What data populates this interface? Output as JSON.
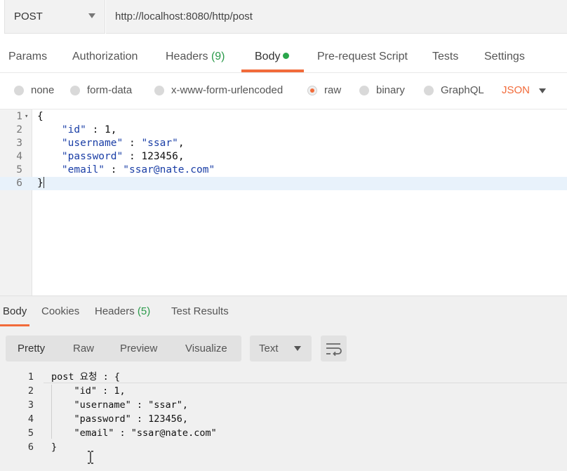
{
  "request": {
    "method": "POST",
    "url": "http://localhost:8080/http/post"
  },
  "request_tabs": {
    "params": "Params",
    "authorization": "Authorization",
    "headers_label": "Headers",
    "headers_count": "(9)",
    "body": "Body",
    "pre_request": "Pre-request Script",
    "tests": "Tests",
    "settings": "Settings"
  },
  "body_types": {
    "none": "none",
    "form_data": "form-data",
    "urlencoded": "x-www-form-urlencoded",
    "raw": "raw",
    "binary": "binary",
    "graphql": "GraphQL",
    "format": "JSON"
  },
  "request_body": {
    "line_numbers": [
      "1",
      "2",
      "3",
      "4",
      "5",
      "6"
    ],
    "open_brace": "{",
    "close_brace": "}",
    "id_key": "\"id\"",
    "id_value": "1",
    "username_key": "\"username\"",
    "username_value": "\"ssar\"",
    "password_key": "\"password\"",
    "password_value": "123456",
    "email_key": "\"email\"",
    "email_value": "\"ssar@nate.com\""
  },
  "response_tabs": {
    "body": "Body",
    "cookies": "Cookies",
    "headers_label": "Headers",
    "headers_count": "(5)",
    "test_results": "Test Results"
  },
  "response_view": {
    "pretty": "Pretty",
    "raw": "Raw",
    "preview": "Preview",
    "visualize": "Visualize",
    "text_format": "Text"
  },
  "response_body": {
    "line_numbers": [
      "1",
      "2",
      "3",
      "4",
      "5",
      "6"
    ],
    "lines": [
      "post 요청 : {",
      "    \"id\" : 1,",
      "    \"username\" : \"ssar\",",
      "    \"password\" : 123456,",
      "    \"email\" : \"ssar@nate.com\"",
      "}"
    ]
  },
  "colors": {
    "accent": "#f26b3a",
    "active_dot": "#2aa64b",
    "string": "#1a3ea6"
  },
  "icons": {
    "method_dropdown": "chevron-down-icon",
    "fold": "fold-arrow-icon",
    "wrap": "word-wrap-icon",
    "cursor": "text-cursor-icon"
  }
}
